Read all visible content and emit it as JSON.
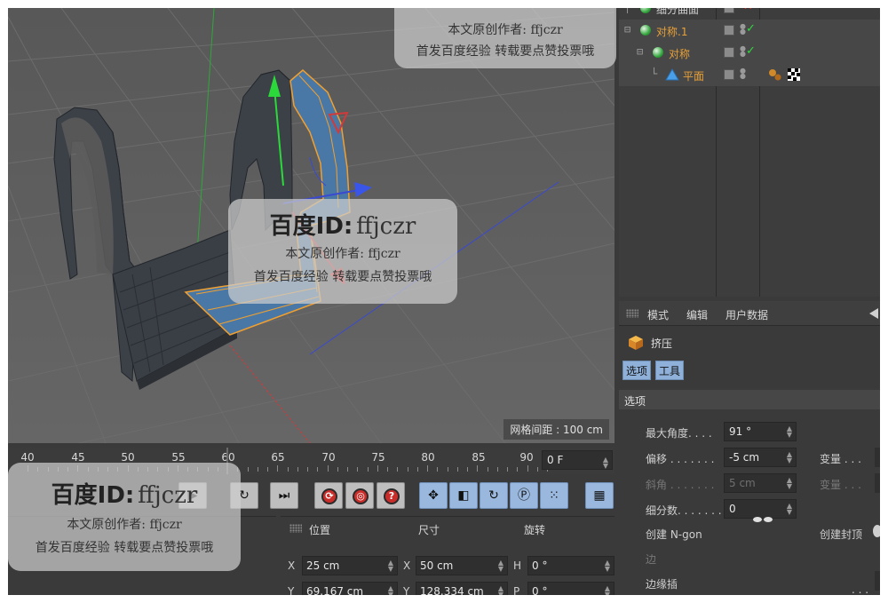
{
  "viewport": {
    "grid_spacing_label": "网格间距 : 100 cm"
  },
  "object_manager": {
    "rows": [
      {
        "name": "细分曲面",
        "color": "#e8a13a",
        "tree": "├"
      },
      {
        "name": "对称.1",
        "color": "#e8a13a",
        "tree": "白"
      },
      {
        "name": "对称",
        "color": "#e8a13a",
        "tree": "白"
      },
      {
        "name": "平面",
        "color": "#e8a13a",
        "tree": "└"
      }
    ]
  },
  "attribute_manager": {
    "menu": [
      "模式",
      "编辑",
      "用户数据"
    ],
    "object_name": "挤压",
    "tabs": [
      "选项",
      "工具"
    ],
    "section": "选项",
    "params": [
      {
        "label": "最大角度. . . .",
        "value": "91 °"
      },
      {
        "label": "偏移 . . . . . . .",
        "value": "-5 cm",
        "right": "变量 . . ."
      },
      {
        "label": "斜角 . . . . . . .",
        "value": "5 cm",
        "right": "变量 . . ."
      },
      {
        "label": "细分数. . . . . . .",
        "value": "0"
      },
      {
        "label": "创建 N-gon",
        "right": "创建封顶"
      },
      {
        "label": "边"
      },
      {
        "label": "边缘插"
      }
    ]
  },
  "timeline": {
    "ticks": [
      "40",
      "45",
      "50",
      "55",
      "60",
      "65",
      "70",
      "75",
      "80",
      "85",
      "90"
    ],
    "current_frame": "0 F"
  },
  "transport": {
    "buttons": [
      "go-end",
      "record-keys",
      "autokey",
      "help",
      "move",
      "scale",
      "rotate",
      "param",
      "points",
      "timeline-film"
    ]
  },
  "coordinates": {
    "headers": [
      "位置",
      "尺寸",
      "旋转"
    ],
    "rows": [
      {
        "pos_axis": "X",
        "pos": "25 cm",
        "size_axis": "X",
        "size": "50 cm",
        "rot_axis": "H",
        "rot": "0 °"
      },
      {
        "pos_axis": "Y",
        "pos": "69.167 cm",
        "size_axis": "Y",
        "size": "128.334 cm",
        "rot_axis": "P",
        "rot": "0 °"
      }
    ]
  },
  "watermarks": {
    "brand": "百度ID:",
    "id": "ffjczr",
    "line1": "本文原创作者: ffjczr",
    "line2": "首发百度经验  转载要点赞投票哦"
  },
  "colors": {
    "accent_blue": "#9ab8de",
    "selection_orange": "#e8a13a",
    "check_green": "#2fd93f"
  }
}
